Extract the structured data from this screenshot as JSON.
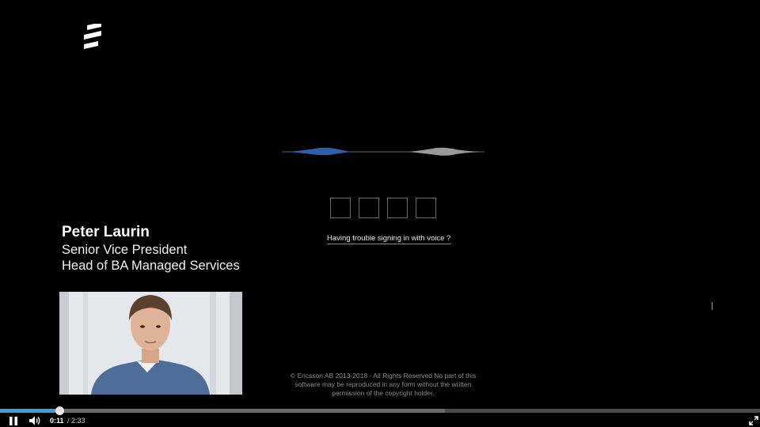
{
  "speaker": {
    "name": "Peter Laurin",
    "title_line1": "Senior Vice President",
    "title_line2": "Head of BA Managed Services"
  },
  "voice_auth": {
    "pin_boxes": 4,
    "trouble_link": "Having trouble signing in with voice ?"
  },
  "footer": {
    "copyright_line1": "© Ericsson AB 2013-2018 - All Rights Reserved No part of this",
    "copyright_line2": "software may be reproduced in any form without the written",
    "copyright_line3": "permission of the copyright holder."
  },
  "player": {
    "current_time": "0:11",
    "total_time": "/ 2:33",
    "progress": 0.078,
    "buffered": 0.585,
    "accent_color": "#3aa0d8"
  },
  "icons": {
    "logo": "ericsson-logo-icon",
    "pause": "pause-icon",
    "volume": "volume-icon",
    "fullscreen": "fullscreen-icon"
  }
}
